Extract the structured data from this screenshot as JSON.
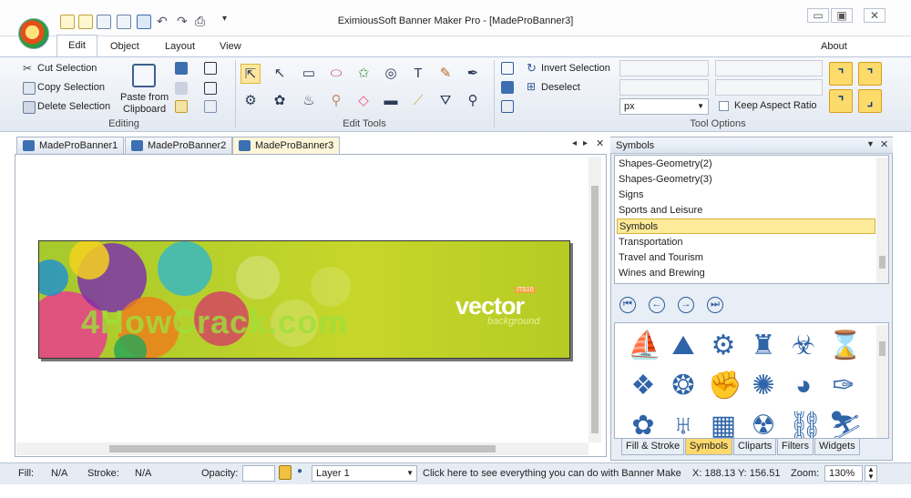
{
  "window": {
    "title": "EximiousSoft Banner Maker Pro - [MadeProBanner3]",
    "min": "▭",
    "restore": "▣",
    "close": "✕"
  },
  "menu": {
    "items": [
      "Edit",
      "Object",
      "Layout",
      "View"
    ],
    "about": "About"
  },
  "ribbon": {
    "editing": {
      "cut": "Cut Selection",
      "copy": "Copy Selection",
      "delete": "Delete Selection",
      "paste_line1": "Paste from",
      "paste_line2": "Clipboard",
      "label": "Editing"
    },
    "edit_tools": {
      "label": "Edit Tools",
      "text_tool": "T"
    },
    "selection": {
      "invert": "Invert Selection",
      "deselect": "Deselect"
    },
    "tool_options": {
      "unit": "px",
      "keep_aspect": "Keep Aspect Ratio",
      "label": "Tool Options"
    }
  },
  "doc_tabs": [
    "MadeProBanner1",
    "MadeProBanner2",
    "MadeProBanner3"
  ],
  "banner": {
    "brand": "vector",
    "sub": "background",
    "tag": "ITS10",
    "watermark": "4HowCrack.com"
  },
  "symbols_panel": {
    "title": "Symbols",
    "categories": [
      "Shapes-Geometry(2)",
      "Shapes-Geometry(3)",
      "Signs",
      "Sports and Leisure",
      "Symbols",
      "Transportation",
      "Travel and Tourism",
      "Wines and Brewing"
    ],
    "selected": "Symbols",
    "nav": [
      "⏮",
      "←",
      "→",
      "⏭"
    ],
    "icons": [
      "sail-icon",
      "mountain-icon",
      "gear-icon",
      "column-icon",
      "biohazard-icon",
      "hourglass-icon",
      "diamond-dots-icon",
      "ring-icon",
      "fist-icon",
      "burst-icon",
      "circle-arrow-icon",
      "feather-icon",
      "flower-icon",
      "bowl-icon",
      "checker-icon",
      "radiation-icon",
      "chain-icon",
      "runner-icon"
    ],
    "tabs": [
      "Fill & Stroke",
      "Symbols",
      "Cliparts",
      "Filters",
      "Widgets"
    ],
    "active_tab": "Symbols"
  },
  "status": {
    "fill_label": "Fill:",
    "fill_value": "N/A",
    "stroke_label": "Stroke:",
    "stroke_value": "N/A",
    "opacity_label": "Opacity:",
    "layer": "Layer 1",
    "hint": "Click here to see everything you can do with Banner Make",
    "coords": "X: 188.13 Y: 156.51",
    "zoom_label": "Zoom:",
    "zoom_value": "130%"
  },
  "colors": {
    "accent": "#fdd86d",
    "ribbon": "#e3e9f2",
    "brand_blue": "#2f64a8"
  }
}
